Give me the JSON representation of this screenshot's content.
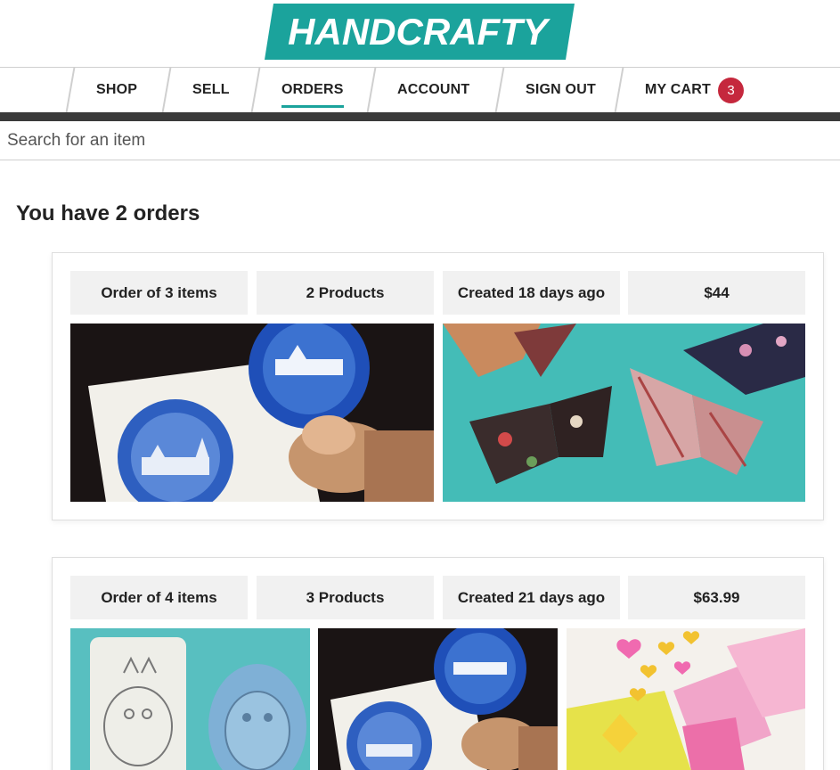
{
  "brand": {
    "logo_text": "HANDCRAFTY",
    "accent": "#1ba39c",
    "badge_color": "#c5283d"
  },
  "nav": {
    "items": [
      {
        "label": "SHOP"
      },
      {
        "label": "SELL"
      },
      {
        "label": "ORDERS",
        "active": true
      },
      {
        "label": "ACCOUNT"
      },
      {
        "label": "SIGN OUT"
      },
      {
        "label": "MY CART"
      }
    ],
    "cart_count": "3"
  },
  "search": {
    "placeholder": "Search for an item",
    "value": ""
  },
  "page": {
    "title": "You have 2 orders"
  },
  "orders": [
    {
      "items_label": "Order of 3 items",
      "products_label": "2 Products",
      "created_label": "Created 18 days ago",
      "total": "$44",
      "thumbnails": [
        "carved-stamp-photo",
        "origami-butterflies-photo"
      ]
    },
    {
      "items_label": "Order of 4 items",
      "products_label": "3 Products",
      "created_label": "Created 21 days ago",
      "total": "$63.99",
      "thumbnails": [
        "totoro-stamp-photo",
        "carved-stamp-photo",
        "origami-birds-photo"
      ]
    }
  ]
}
